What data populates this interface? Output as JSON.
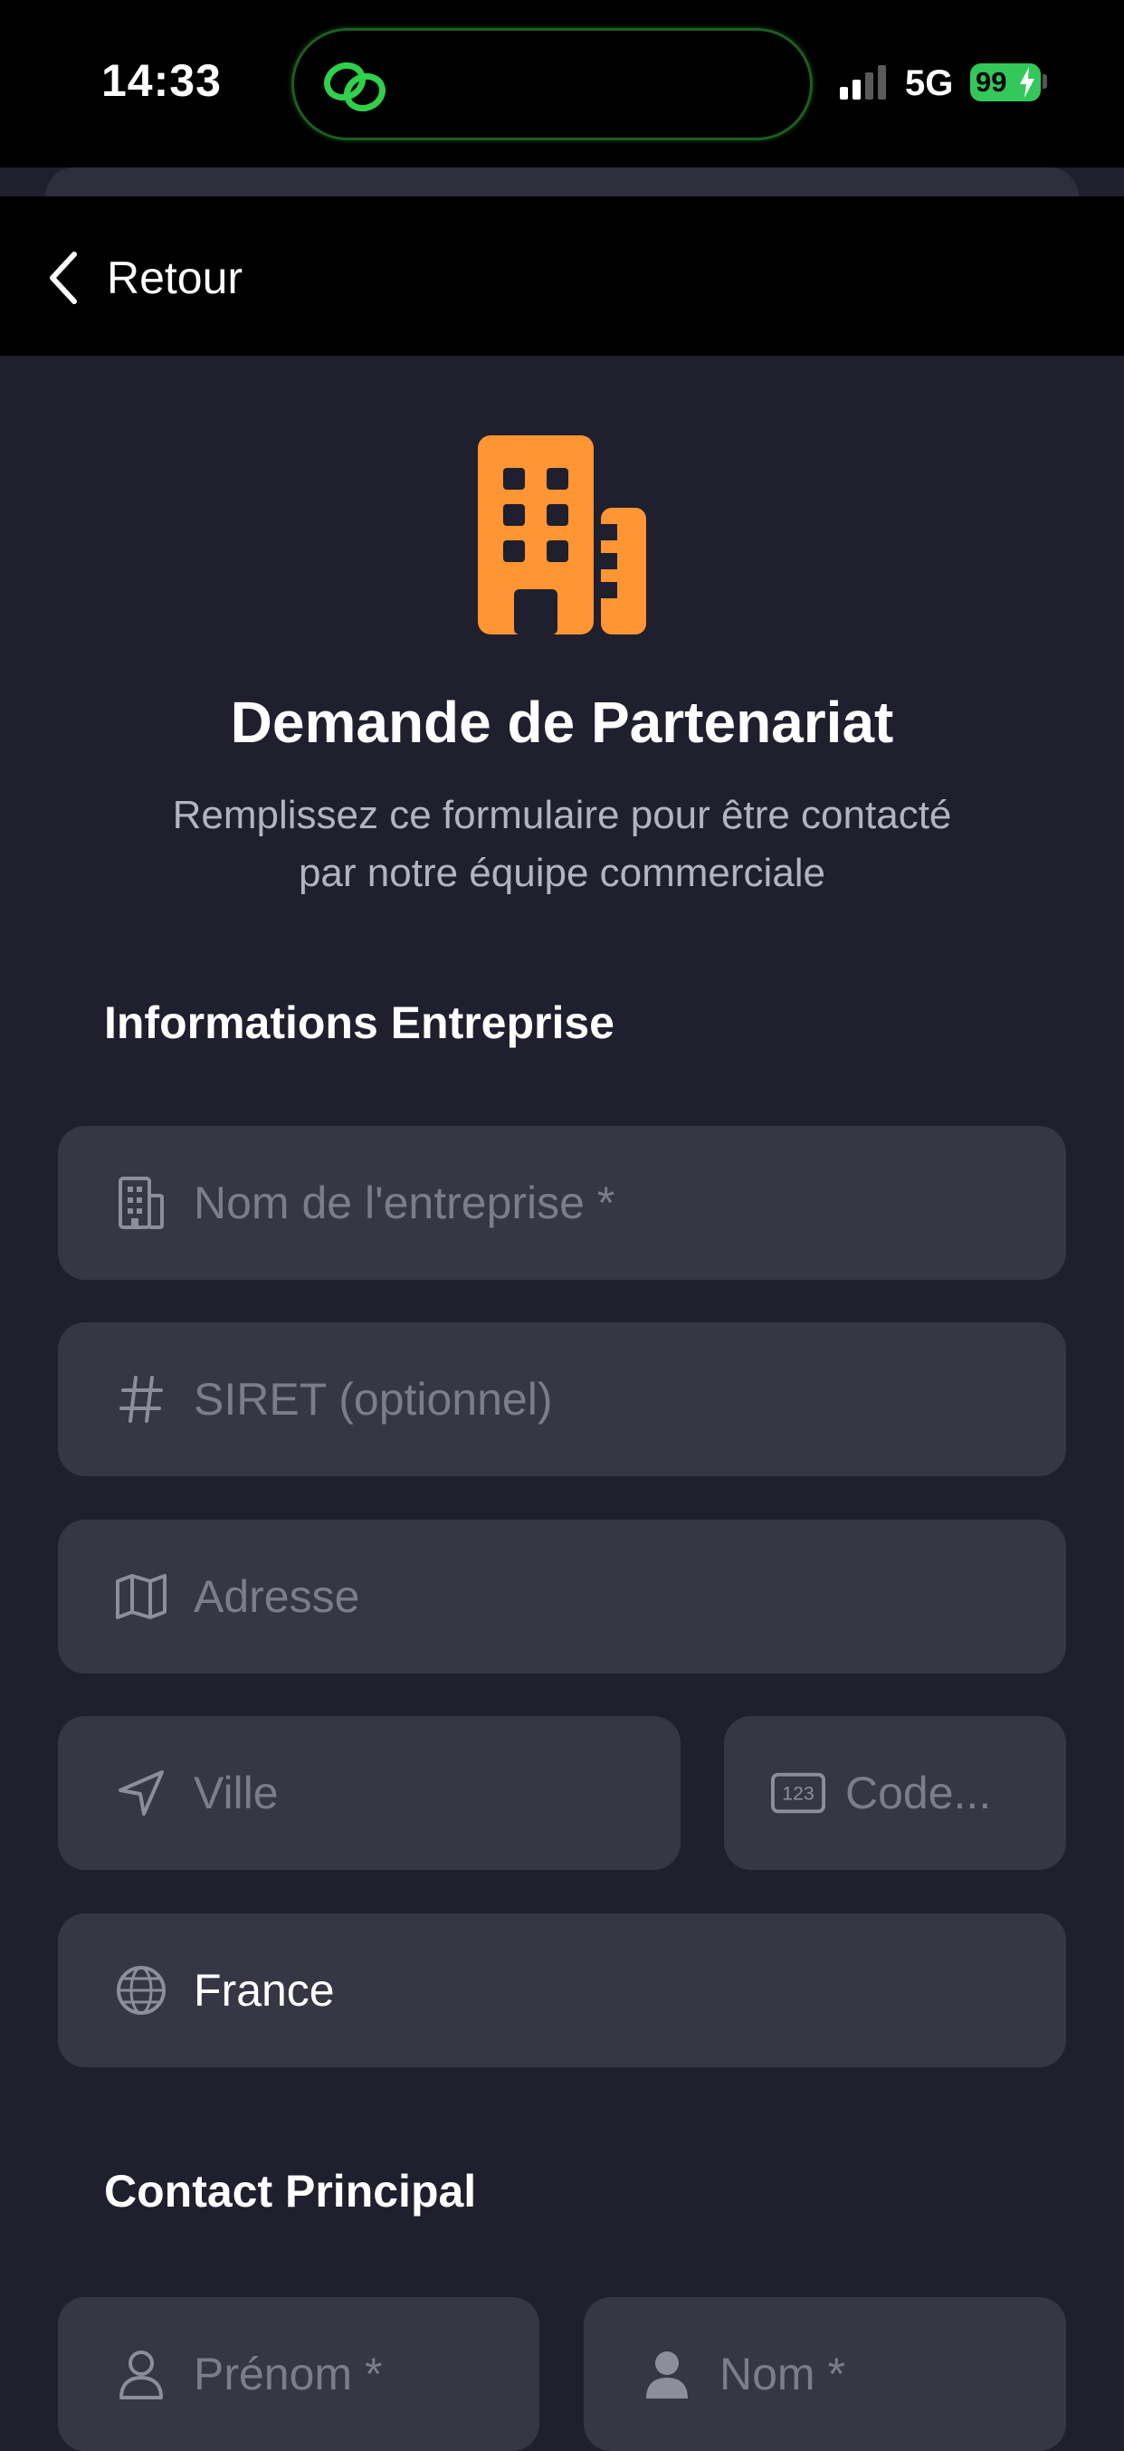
{
  "status_bar": {
    "time": "14:33",
    "network": "5G",
    "battery": "99"
  },
  "nav": {
    "back_label": "Retour"
  },
  "header": {
    "title": "Demande de Partenariat",
    "subtitle_line1": "Remplissez ce formulaire pour être contacté",
    "subtitle_line2": "par notre équipe commerciale"
  },
  "company_section": {
    "title": "Informations Entreprise",
    "company_name": {
      "placeholder": "Nom de l'entreprise *",
      "value": ""
    },
    "siret": {
      "placeholder": "SIRET (optionnel)",
      "value": ""
    },
    "address": {
      "placeholder": "Adresse",
      "value": ""
    },
    "city": {
      "placeholder": "Ville",
      "value": ""
    },
    "postal_code": {
      "placeholder": "Code...",
      "value": ""
    },
    "country": {
      "value": "France"
    }
  },
  "contact_section": {
    "title": "Contact Principal",
    "first_name": {
      "placeholder": "Prénom *",
      "value": ""
    },
    "last_name": {
      "placeholder": "Nom *",
      "value": ""
    }
  },
  "colors": {
    "background": "#1f1f2e",
    "field_bg": "#363644",
    "accent_orange": "#ff9533",
    "battery_green": "#34c759",
    "island_icon_green": "#2fd04a"
  }
}
